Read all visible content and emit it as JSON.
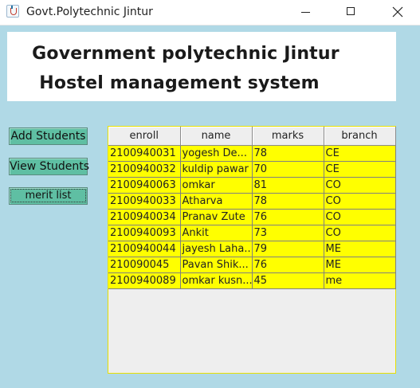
{
  "window": {
    "title": "Govt.Polytechnic Jintur",
    "controls": {
      "minimize_icon": "minimize-icon",
      "maximize_icon": "maximize-icon",
      "close_icon": "close-icon"
    }
  },
  "banner": {
    "line1": "Government polytechnic Jintur",
    "line2": "Hostel management system"
  },
  "buttons": {
    "add_students": "Add Students",
    "view_students": "View Students",
    "merit_list": "merit list"
  },
  "table": {
    "columns": [
      "enroll",
      "name",
      "marks",
      "branch"
    ],
    "rows": [
      [
        "2100940031",
        "yogesh De...",
        "78",
        "CE"
      ],
      [
        "2100940032",
        "kuldip pawar",
        "70",
        "CE"
      ],
      [
        "2100940063",
        "omkar",
        "81",
        "CO"
      ],
      [
        "2100940033",
        "Atharva",
        "78",
        "CO"
      ],
      [
        "2100940034",
        "Pranav Zute",
        "76",
        "CO"
      ],
      [
        "2100940093",
        "Ankit",
        "73",
        "CO"
      ],
      [
        "2100940044",
        "jayesh Laha...",
        "79",
        "ME"
      ],
      [
        "210090045",
        "Pavan Shik...",
        "76",
        "ME"
      ],
      [
        "2100940089",
        "omkar kusn...",
        "45",
        "me"
      ]
    ]
  },
  "colors": {
    "background": "#b0d9e6",
    "button": "#5fbfa3",
    "row_highlight": "#ffff00"
  }
}
